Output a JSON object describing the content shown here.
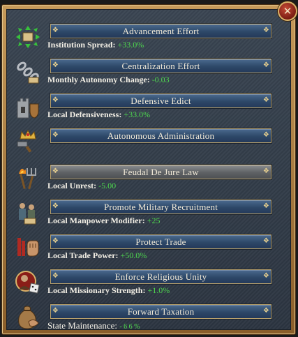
{
  "close_icon": "close-x-icon",
  "colors": {
    "positive": "#4ed84e",
    "frame": "#c69a5a",
    "banner": "#2d4868",
    "banner_inactive": "#5e6164"
  },
  "edicts": [
    {
      "title": "Advancement Effort",
      "effect_label": "Institution Spread:",
      "effect_value": "+33.0%",
      "icon": "arrows-scroll-icon"
    },
    {
      "title": "Centralization Effort",
      "effect_label": "Monthly Autonomy Change:",
      "effect_value": "-0.03",
      "icon": "chain-icon"
    },
    {
      "title": "Defensive Edict",
      "effect_label": "Local Defensiveness:",
      "effect_value": "+33.0%",
      "icon": "fortress-shield-icon"
    },
    {
      "title": "Autonomous Administration",
      "effect_label": "",
      "effect_value": "",
      "icon": "crown-hammer-icon"
    },
    {
      "title": "Feudal De Jure Law",
      "effect_label": "Local Unrest:",
      "effect_value": "-5.00",
      "icon": "torch-pitchfork-icon",
      "inactive": true
    },
    {
      "title": "Promote Military Recruitment",
      "effect_label": "Local Manpower Modifier:",
      "effect_value": "+25",
      "icon": "soldiers-icon"
    },
    {
      "title": "Protect Trade",
      "effect_label": "Local Trade Power:",
      "effect_value": "+50.0%",
      "icon": "trade-fist-icon"
    },
    {
      "title": "Enforce Religious Unity",
      "effect_label": "Local Missionary Strength:",
      "effect_value": "+1.0%",
      "icon": "missionary-dice-icon"
    },
    {
      "title": "Forward Taxation",
      "effect_label": "State Maintenance:",
      "effect_value": "- 6 6 %",
      "icon": "money-bag-icon"
    }
  ]
}
